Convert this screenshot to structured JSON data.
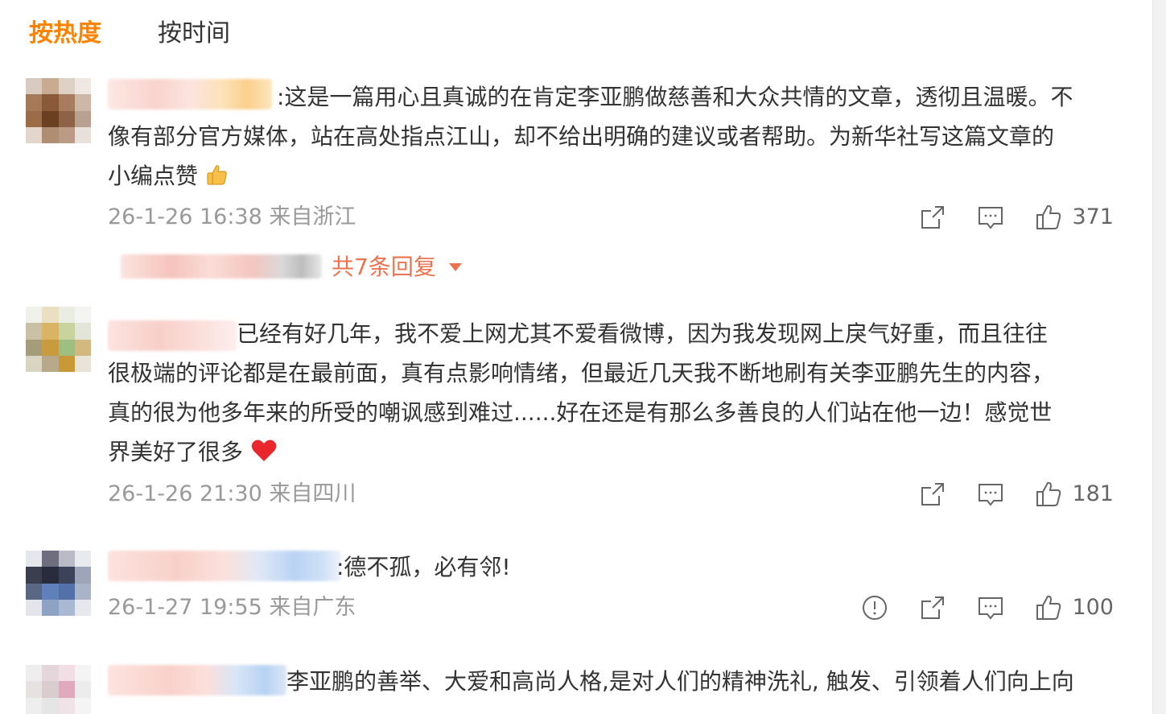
{
  "tabs": {
    "hot": "按热度",
    "time": "按时间"
  },
  "colors": {
    "accent": "#ff8200",
    "reply_link": "#eb7350",
    "meta": "#999999",
    "text": "#333333"
  },
  "comments": [
    {
      "text_lines": [
        ":这是一篇用心且真诚的在肯定李亚鹏做慈善和大众共情的文章，透彻且温暖。不",
        "像有部分官方媒体，站在高处指点江山，却不给出明确的建议或者帮助。为新华社写这篇文章的",
        "小编点赞"
      ],
      "emoji": "thumbs-up-emoji",
      "timestamp": "26-1-26 16:38",
      "location": "来自浙江",
      "likes": "371",
      "replies_label": "共7条回复"
    },
    {
      "text_lines": [
        "已经有好几年，我不爱上网尤其不爱看微博，因为我发现网上戾气好重，而且往往",
        "很极端的评论都是在最前面，真有点影响情绪，但最近几天我不断地刷有关李亚鹏先生的内容，",
        "真的很为他多年来的所受的嘲讽感到难过......好在还是有那么多善良的人们站在他一边！感觉世",
        "界美好了很多"
      ],
      "emoji": "red-heart-emoji",
      "timestamp": "26-1-26 21:30",
      "location": "来自四川",
      "likes": "181"
    },
    {
      "text_lines": [
        ":德不孤，必有邻!"
      ],
      "timestamp": "26-1-27 19:55",
      "location": "来自广东",
      "likes": "100"
    },
    {
      "text_lines": [
        "李亚鹏的善举、大爱和高尚人格,是对人们的精神洗礼, 触发、引领着人们向上向"
      ]
    }
  ],
  "icons": {
    "report": "report-icon",
    "share": "share-icon",
    "comment": "comment-icon",
    "like": "thumbs-up-icon",
    "dropdown": "caret-down-icon"
  }
}
